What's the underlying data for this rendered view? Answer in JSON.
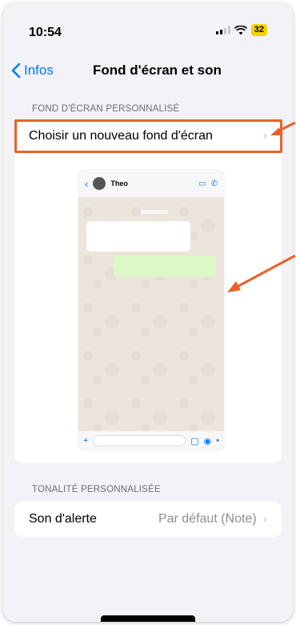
{
  "status_bar": {
    "time": "10:54",
    "battery": "32"
  },
  "nav": {
    "back_label": "Infos",
    "title": "Fond d'écran et son"
  },
  "wallpaper_section": {
    "header": "FOND D'ÉCRAN PERSONNALISÉ",
    "choose_label": "Choisir un nouveau fond d'écran"
  },
  "preview": {
    "contact_name": "Theo"
  },
  "tone_section": {
    "header": "TONALITÉ PERSONNALISÉE",
    "alert_label": "Son d'alerte",
    "alert_value": "Par défaut (Note)"
  },
  "annotation_color": "#e8622a",
  "accent_color": "#007aff",
  "icons": [
    "chevron-left-icon",
    "chevron-right-icon",
    "signal-icon",
    "wifi-icon",
    "battery-icon",
    "video-call-icon",
    "phone-icon",
    "plus-icon",
    "sticker-icon",
    "camera-icon",
    "microphone-icon"
  ]
}
